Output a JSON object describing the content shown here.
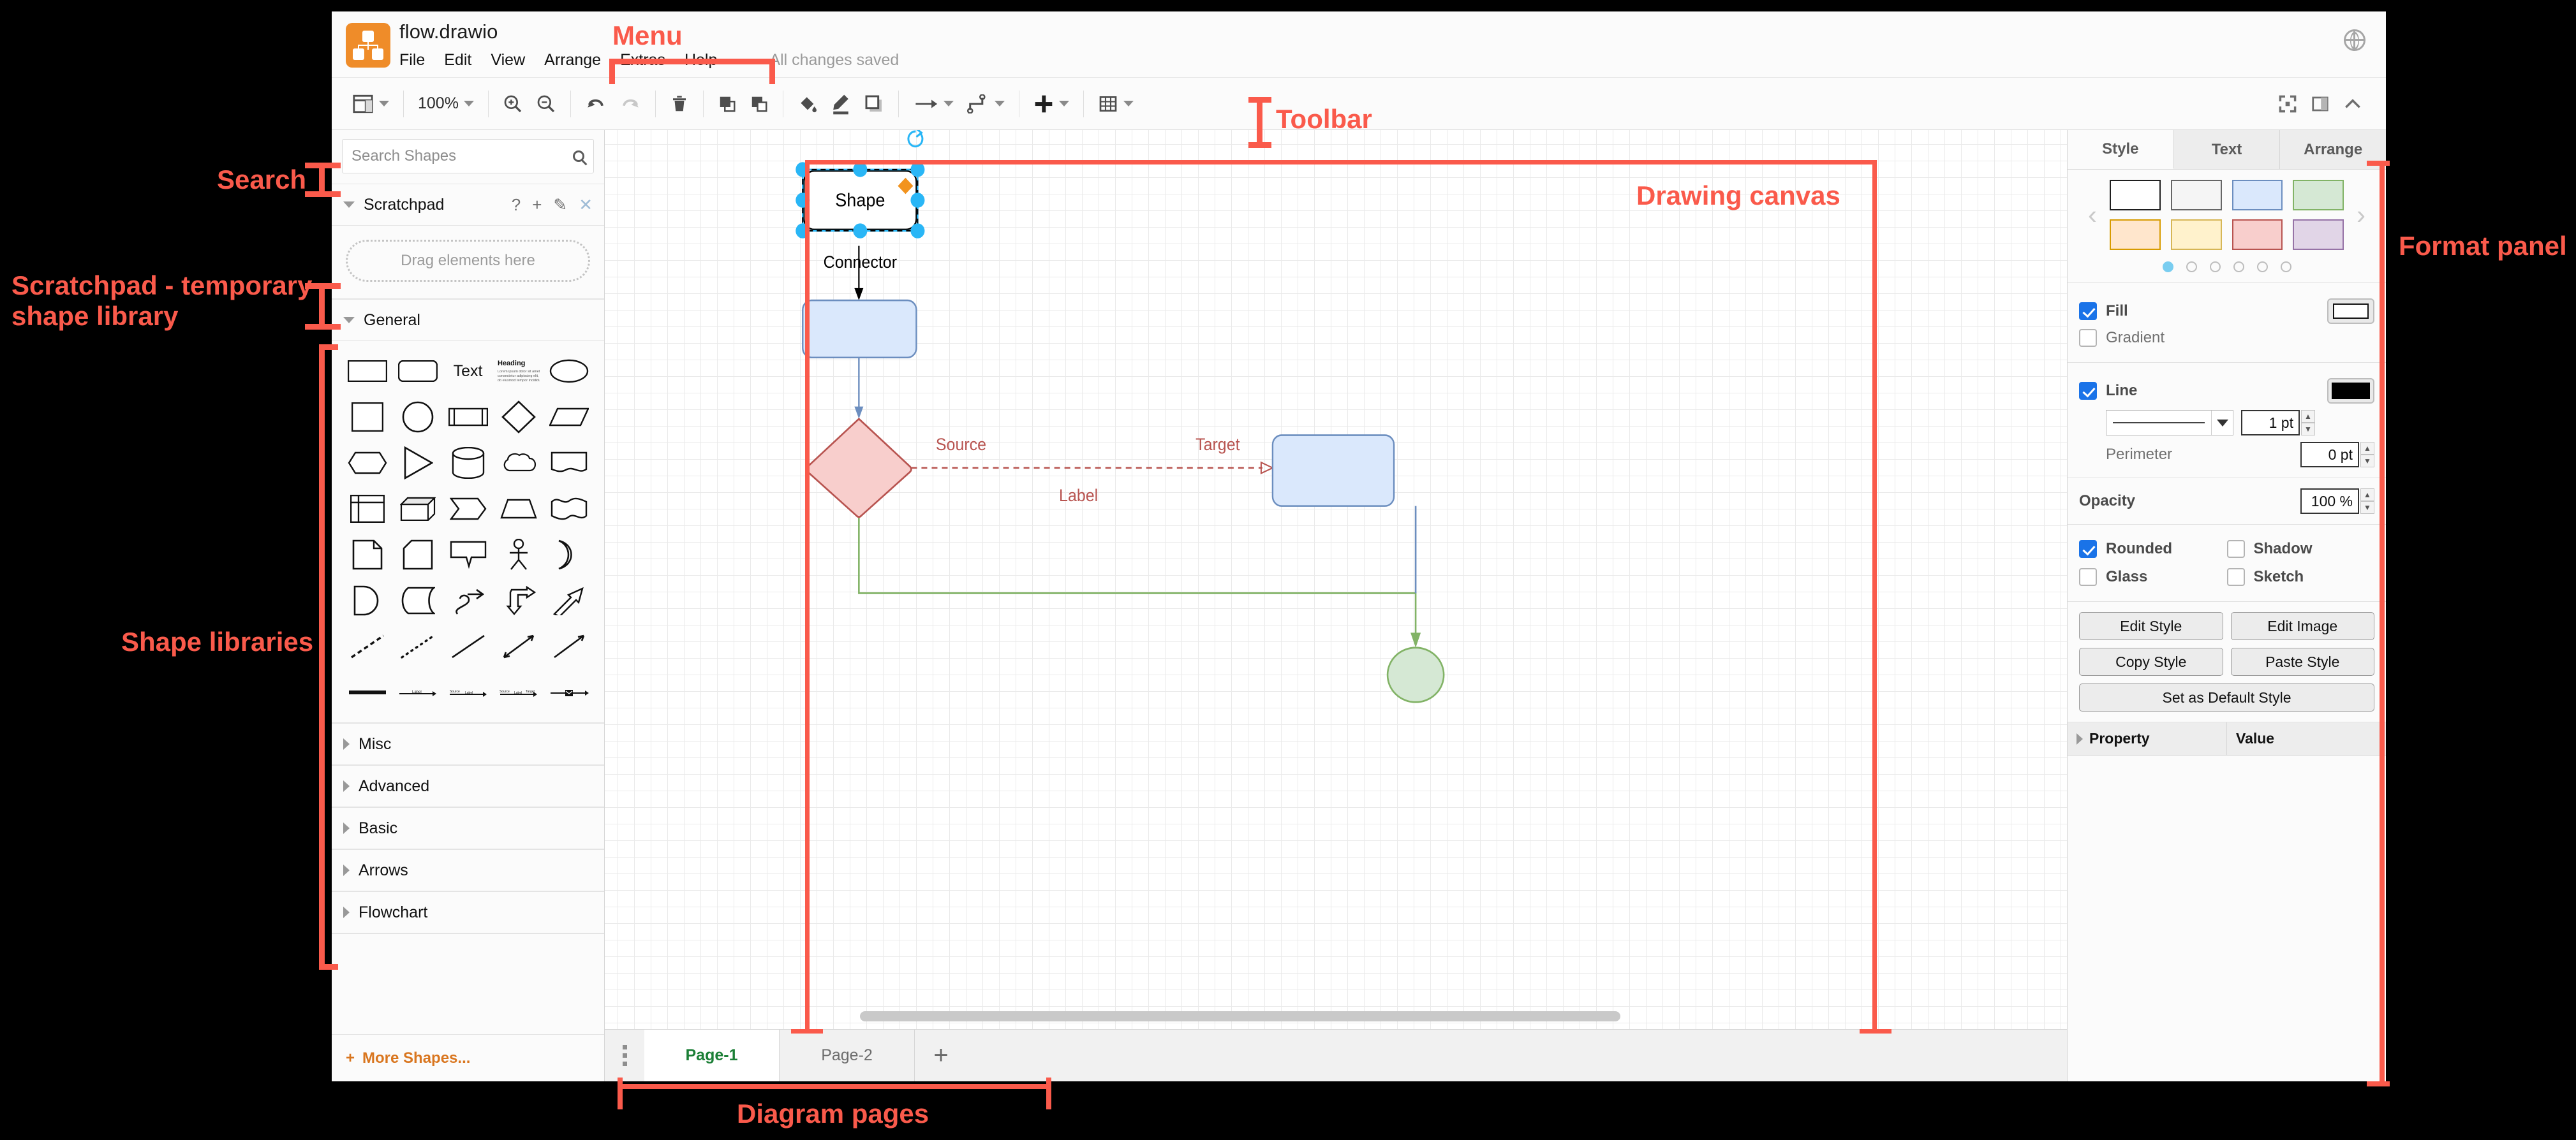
{
  "app": {
    "filename": "flow.drawio",
    "status": "All changes saved",
    "logo_icon": "drawio-logo-icon",
    "globe_icon": "globe-icon"
  },
  "menu": {
    "items": [
      "File",
      "Edit",
      "View",
      "Arrange",
      "Extras",
      "Help"
    ]
  },
  "toolbar": {
    "view_icon": "view-layout-icon",
    "zoom_label": "100%",
    "zoom_in_icon": "zoom-in-icon",
    "zoom_out_icon": "zoom-out-icon",
    "undo_icon": "undo-icon",
    "redo_icon": "redo-icon",
    "delete_icon": "trash-icon",
    "to_front_icon": "bring-to-front-icon",
    "to_back_icon": "send-to-back-icon",
    "fill_color_icon": "fill-color-icon",
    "line_color_icon": "line-color-icon",
    "shadow_icon": "shadow-icon",
    "connection_icon": "connection-arrow-icon",
    "waypoints_icon": "waypoints-icon",
    "insert_icon": "insert-plus-icon",
    "table_icon": "table-grid-icon",
    "fullscreen_icon": "fullscreen-icon",
    "format_panel_icon": "toggle-format-panel-icon",
    "collapse_icon": "collapse-chevron-icon"
  },
  "sidebar": {
    "search": {
      "placeholder": "Search Shapes",
      "value": "",
      "icon": "search-icon"
    },
    "scratchpad": {
      "title": "Scratchpad",
      "dropzone": "Drag elements here",
      "help_icon": "help-question-icon",
      "add_icon": "plus-icon",
      "edit_icon": "pencil-icon",
      "close_icon": "close-x-icon"
    },
    "general": {
      "title": "General"
    },
    "shapes": [
      "rectangle",
      "rounded-rectangle",
      "text",
      "textbox-heading",
      "ellipse",
      "square",
      "circle",
      "process",
      "diamond",
      "parallelogram",
      "hexagon",
      "triangle",
      "cylinder",
      "cloud",
      "document",
      "internal-storage",
      "cube",
      "step",
      "trapezoid",
      "tape",
      "note",
      "card",
      "callout",
      "actor",
      "or",
      "and",
      "data-storage",
      "curved-arrow",
      "double-arrow",
      "arrow",
      "dashed-line",
      "dotted-line",
      "line",
      "bidirectional-arrow",
      "directional-arrow",
      "thick-line",
      "link-label",
      "link-label-2",
      "link-3-labels",
      "edge-with-icon"
    ],
    "categories": [
      "Misc",
      "Advanced",
      "Basic",
      "Arrows",
      "Flowchart"
    ],
    "more_shapes": "More Shapes..."
  },
  "pages": {
    "menu_icon": "page-menu-icon",
    "tabs": [
      {
        "label": "Page-1",
        "active": true
      },
      {
        "label": "Page-2",
        "active": false
      }
    ],
    "add_icon": "add-page-icon"
  },
  "format": {
    "tabs": [
      {
        "label": "Style",
        "active": true
      },
      {
        "label": "Text",
        "active": false
      },
      {
        "label": "Arrange",
        "active": false
      }
    ],
    "swatches": [
      {
        "fill": "#ffffff",
        "stroke": "#1f1f1f"
      },
      {
        "fill": "#f5f5f5",
        "stroke": "#666666"
      },
      {
        "fill": "#dae8fc",
        "stroke": "#6c8ebf"
      },
      {
        "fill": "#d5e8d4",
        "stroke": "#82b366"
      },
      {
        "fill": "#ffe6cc",
        "stroke": "#d79b00"
      },
      {
        "fill": "#fff2cc",
        "stroke": "#d6b656"
      },
      {
        "fill": "#f8cecc",
        "stroke": "#b85450"
      },
      {
        "fill": "#e1d5e7",
        "stroke": "#9673a6"
      }
    ],
    "swatch_pages": 6,
    "swatch_page_active": 1,
    "prev_icon": "chevron-left-icon",
    "next_icon": "chevron-right-icon",
    "fill": {
      "label": "Fill",
      "checked": true,
      "color": "#ffffff"
    },
    "gradient": {
      "label": "Gradient",
      "checked": false
    },
    "line": {
      "label": "Line",
      "checked": true,
      "color": "#000000",
      "style": "solid",
      "width": "1 pt"
    },
    "perimeter": {
      "label": "Perimeter",
      "value": "0 pt"
    },
    "opacity": {
      "label": "Opacity",
      "value": "100 %"
    },
    "rounded": {
      "label": "Rounded",
      "checked": true
    },
    "shadow": {
      "label": "Shadow",
      "checked": false
    },
    "glass": {
      "label": "Glass",
      "checked": false
    },
    "sketch": {
      "label": "Sketch",
      "checked": false
    },
    "buttons": [
      "Edit Style",
      "Edit Image",
      "Copy Style",
      "Paste Style",
      "Set as Default Style"
    ],
    "property_table": {
      "col1": "Property",
      "col2": "Value"
    }
  },
  "canvas": {
    "nodes": [
      {
        "id": "n1",
        "label": "Shape",
        "shape": "rounded-rect",
        "fill": "#ffffff",
        "stroke": "#000000",
        "selected": true
      },
      {
        "id": "n2",
        "label": "",
        "shape": "rounded-rect",
        "fill": "#dae8fc",
        "stroke": "#6c8ebf",
        "selected": false
      },
      {
        "id": "n3",
        "label": "",
        "shape": "rhombus",
        "fill": "#f8cecc",
        "stroke": "#b85450",
        "selected": false
      },
      {
        "id": "n4",
        "label": "",
        "shape": "rounded-rect",
        "fill": "#dae8fc",
        "stroke": "#6c8ebf",
        "selected": false
      },
      {
        "id": "n5",
        "label": "",
        "shape": "ellipse",
        "fill": "#d5e8d4",
        "stroke": "#82b366",
        "selected": false
      }
    ],
    "edges": [
      {
        "from": "n1",
        "to": "n2",
        "label": "Connector",
        "style": "solid",
        "color": "#000000"
      },
      {
        "from": "n2",
        "to": "n3",
        "label": "",
        "style": "solid",
        "color": "#6c8ebf"
      },
      {
        "from": "n3",
        "to": "n4",
        "label": "Label",
        "source_label": "Source",
        "target_label": "Target",
        "style": "dashed",
        "color": "#b85450"
      },
      {
        "from": "n3",
        "to": "n5",
        "label": "",
        "style": "orthogonal",
        "color": "#82b366"
      },
      {
        "from": "n4",
        "to": "n5",
        "label": "",
        "style": "orthogonal",
        "color": "#6c8ebf"
      }
    ]
  },
  "annotations": [
    {
      "id": "menu",
      "text": "Menu"
    },
    {
      "id": "toolbar",
      "text": "Toolbar"
    },
    {
      "id": "search",
      "text": "Search"
    },
    {
      "id": "scratchpad",
      "text": "Scratchpad - temporary\nshape library"
    },
    {
      "id": "shapelibs",
      "text": "Shape libraries"
    },
    {
      "id": "canvas",
      "text": "Drawing canvas"
    },
    {
      "id": "formatpanel",
      "text": "Format panel"
    },
    {
      "id": "pages",
      "text": "Diagram pages"
    }
  ]
}
